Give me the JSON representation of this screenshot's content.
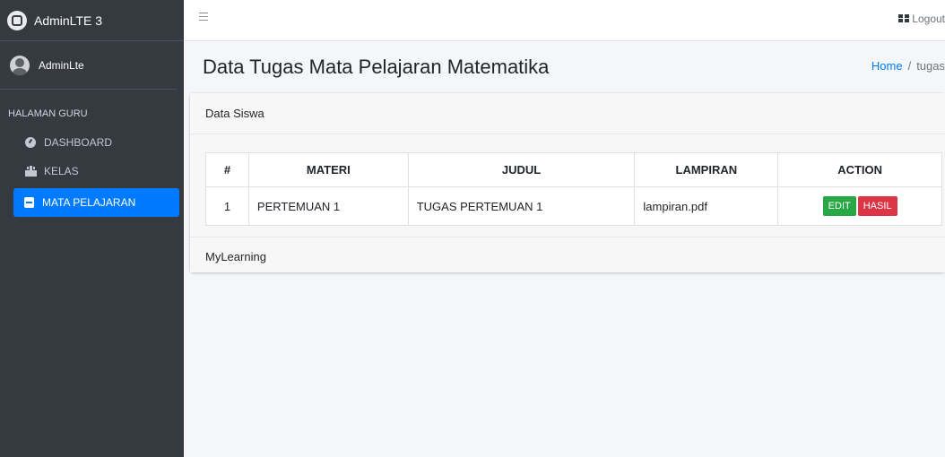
{
  "brand": {
    "title": "AdminLTE 3"
  },
  "user": {
    "name": "AdminLte"
  },
  "sidebar": {
    "header": "HALAMAN GURU",
    "items": [
      {
        "label": "DASHBOARD",
        "icon": "dashboard-icon"
      },
      {
        "label": "KELAS",
        "icon": "school-icon"
      },
      {
        "label": "MATA PELAJARAN",
        "icon": "book-icon",
        "active": true
      }
    ]
  },
  "navbar": {
    "logout": "Logout"
  },
  "page": {
    "title": "Data Tugas Mata Pelajaran Matematika",
    "breadcrumb": {
      "home": "Home",
      "separator": "/",
      "current": "tugas"
    }
  },
  "card": {
    "header": "Data Siswa",
    "footer": "MyLearning",
    "table": {
      "columns": [
        "#",
        "MATERI",
        "JUDUL",
        "LAMPIRAN",
        "ACTION"
      ],
      "rows": [
        {
          "no": "1",
          "materi": "PERTEMUAN 1",
          "judul": "TUGAS PERTEMUAN 1",
          "lampiran": "lampiran.pdf",
          "edit": "EDIT",
          "hasil": "HASIL"
        }
      ]
    }
  },
  "colors": {
    "sidebar": "#343a40",
    "primary": "#007bff",
    "success": "#28a745",
    "danger": "#dc3545"
  }
}
